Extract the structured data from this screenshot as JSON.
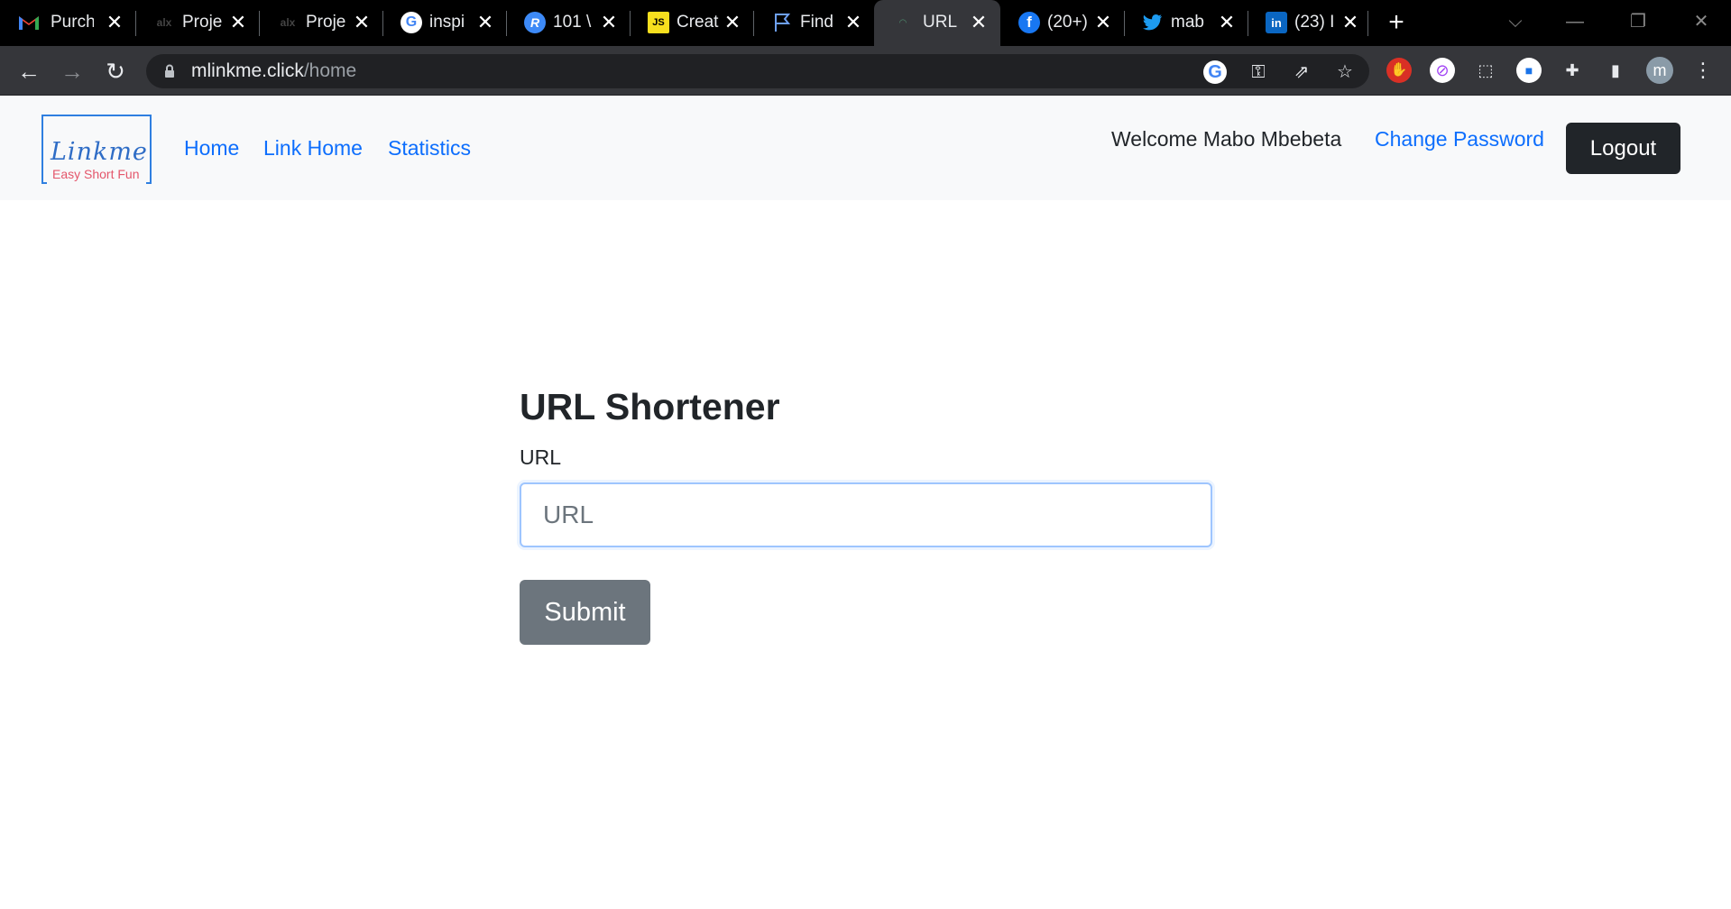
{
  "browser": {
    "tabs": [
      {
        "title": "Purch",
        "icon": "gmail-icon"
      },
      {
        "title": "Proje",
        "icon": "alx-icon"
      },
      {
        "title": "Proje",
        "icon": "alx-icon"
      },
      {
        "title": "inspi",
        "icon": "google-icon"
      },
      {
        "title": "101 \\",
        "icon": "r-icon"
      },
      {
        "title": "Creat",
        "icon": "js-icon"
      },
      {
        "title": "Find",
        "icon": "flag-icon"
      },
      {
        "title": "URL I",
        "icon": "linkme-icon"
      },
      {
        "title": "(20+)",
        "icon": "facebook-icon"
      },
      {
        "title": "mab",
        "icon": "twitter-icon"
      },
      {
        "title": "(23) I",
        "icon": "linkedin-icon"
      }
    ],
    "active_tab_index": 7,
    "url_host": "mlinkme.click",
    "url_path": "/home",
    "profile_initial": "m"
  },
  "navbar": {
    "logo_word": "Linkme",
    "logo_tagline": "Easy Short Fun",
    "links": [
      "Home",
      "Link Home",
      "Statistics"
    ],
    "welcome": "Welcome Mabo Mbebeta",
    "change_password": "Change Password",
    "logout": "Logout"
  },
  "form": {
    "heading": "URL Shortener",
    "label": "URL",
    "placeholder": "URL",
    "value": "",
    "submit": "Submit"
  },
  "colors": {
    "link": "#0d6efd",
    "dark_button": "#212529",
    "submit_button": "#6c757d"
  }
}
